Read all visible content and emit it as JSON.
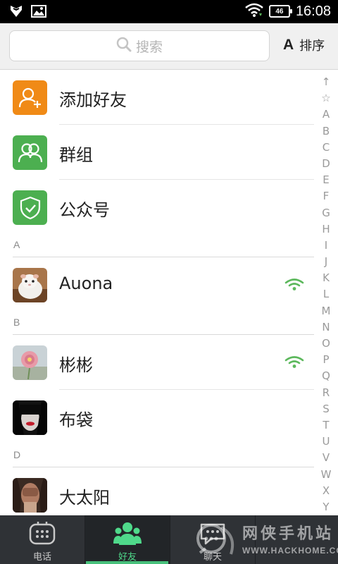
{
  "status_bar": {
    "time": "16:08",
    "network": "46"
  },
  "search": {
    "placeholder": "搜索"
  },
  "sort": {
    "icon_letter": "A",
    "label": "排序"
  },
  "specials": [
    {
      "label": "添加好友",
      "icon": "add-friend-icon",
      "color": "#f08a16"
    },
    {
      "label": "群组",
      "icon": "group-icon",
      "color": "#4caf50"
    },
    {
      "label": "公众号",
      "icon": "shield-check-icon",
      "color": "#4caf50"
    }
  ],
  "sections": [
    {
      "letter": "A",
      "contacts": [
        {
          "name": "Auona",
          "online": true
        }
      ]
    },
    {
      "letter": "B",
      "contacts": [
        {
          "name": "彬彬",
          "online": true
        },
        {
          "name": "布袋",
          "online": false
        }
      ]
    },
    {
      "letter": "D",
      "contacts": [
        {
          "name": "大太阳",
          "online": false
        }
      ]
    }
  ],
  "index_letters": [
    "↑",
    "☆",
    "A",
    "B",
    "C",
    "D",
    "E",
    "F",
    "G",
    "H",
    "I",
    "J",
    "K",
    "L",
    "M",
    "N",
    "O",
    "P",
    "Q",
    "R",
    "S",
    "T",
    "U",
    "V",
    "W",
    "X",
    "Y"
  ],
  "bottom_nav": [
    {
      "label": "电话",
      "icon": "dialpad-icon",
      "active": false
    },
    {
      "label": "好友",
      "icon": "friends-icon",
      "active": true
    },
    {
      "label": "聊天",
      "icon": "chat-icon",
      "active": false
    }
  ],
  "watermark": {
    "text": "网侠手机站",
    "url": "WWW.HACKHOME.COM"
  },
  "colors": {
    "accent": "#47c07b",
    "online": "#5cb85c",
    "nav_bg": "#2f3236"
  }
}
